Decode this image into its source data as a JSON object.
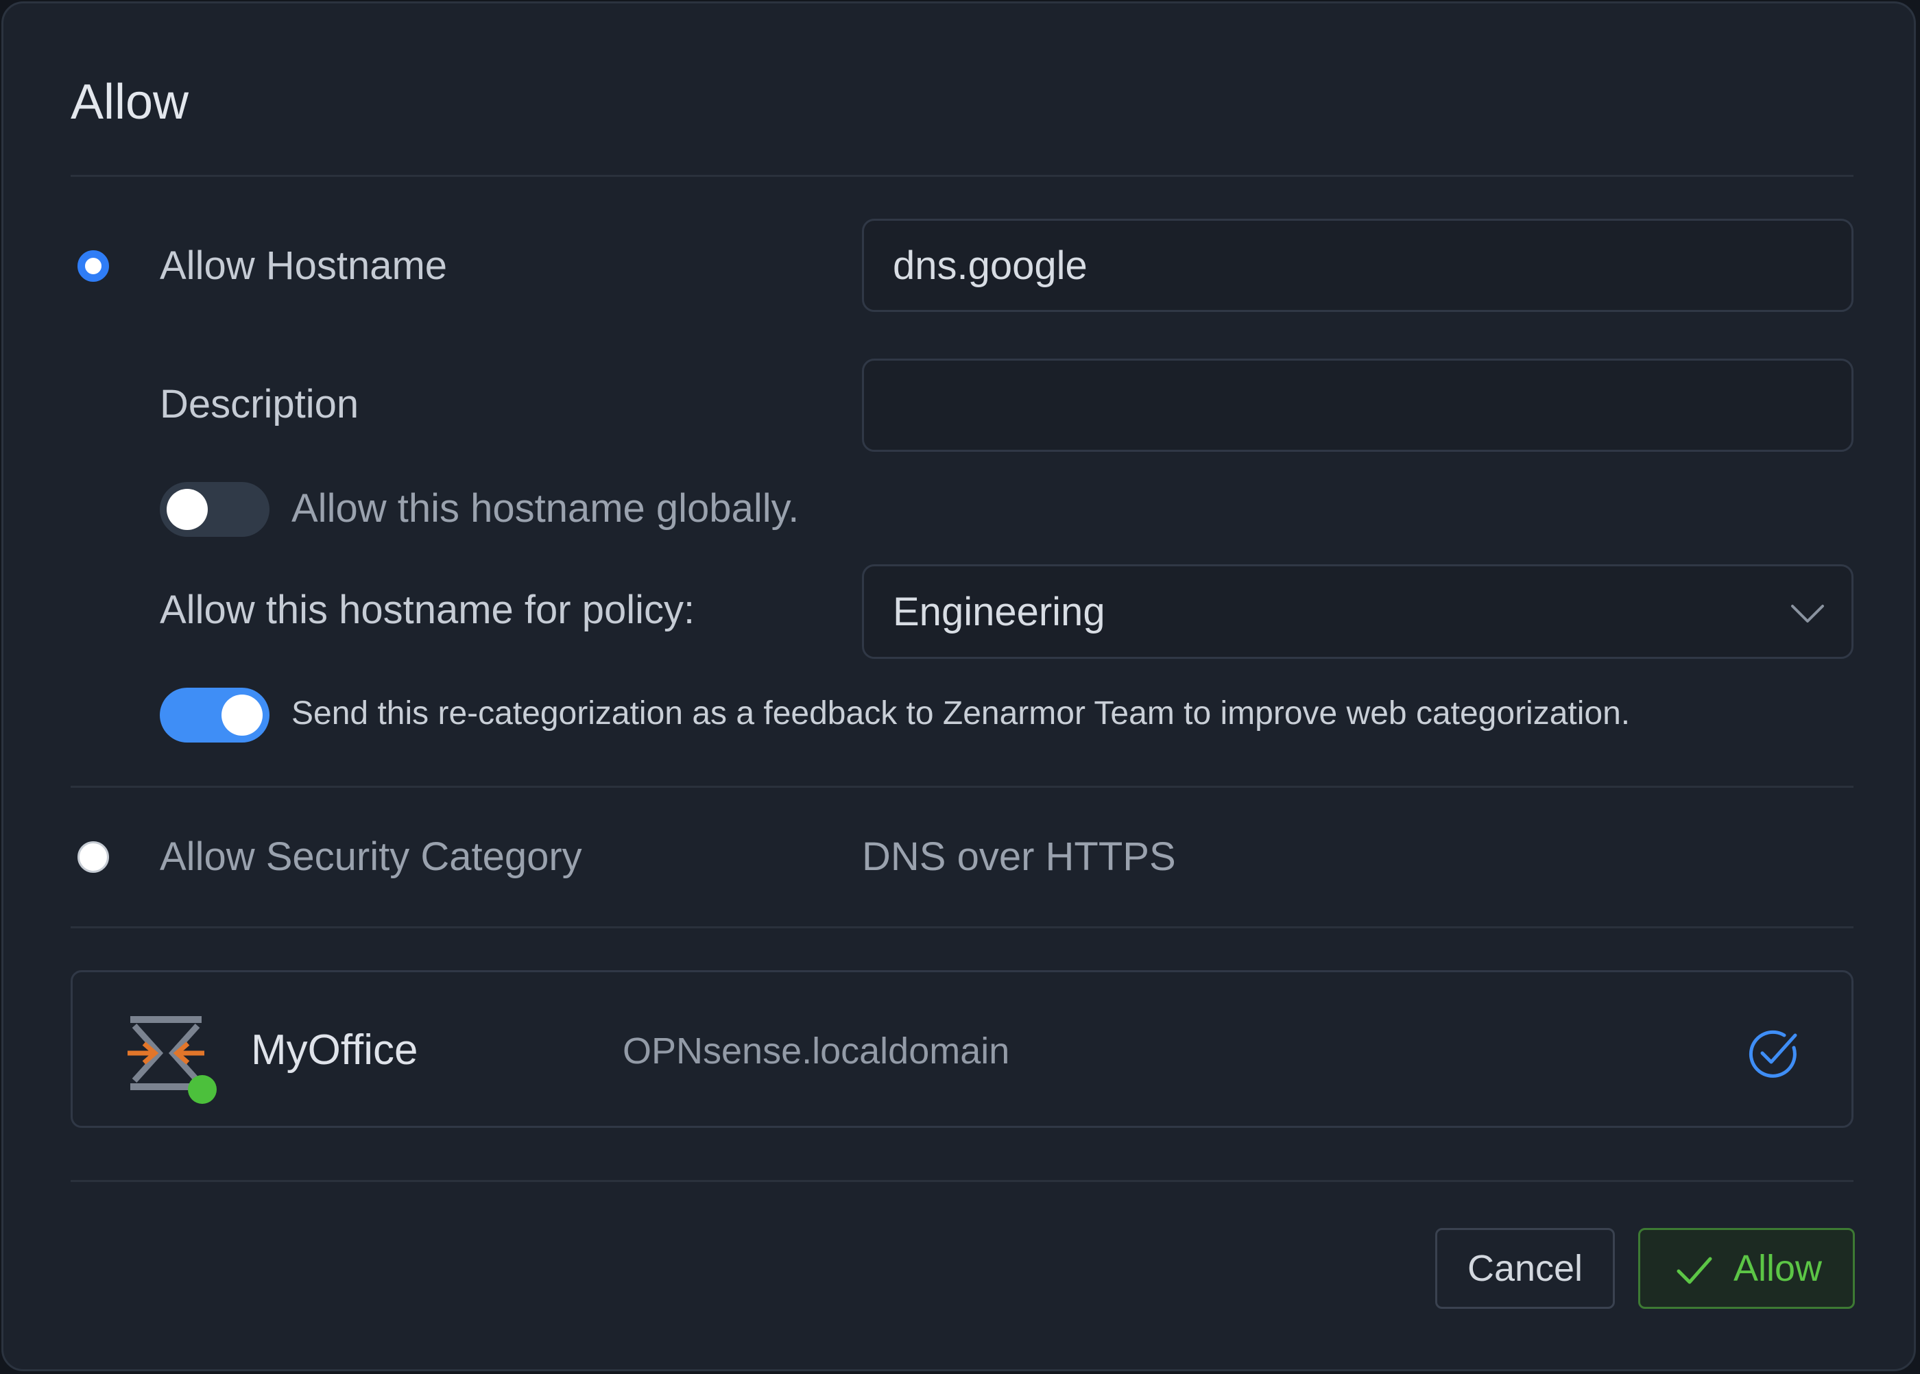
{
  "dialog": {
    "title": "Allow"
  },
  "allow_hostname": {
    "radio_label": "Allow Hostname",
    "hostname_value": "dns.google",
    "description_label": "Description",
    "description_value": "",
    "global_toggle_label": "Allow this hostname globally.",
    "global_toggle_on": false,
    "policy_label": "Allow this hostname for policy:",
    "policy_selected": "Engineering",
    "feedback_toggle_label": "Send this re-categorization as a feedback to Zenarmor Team to improve web categorization.",
    "feedback_toggle_on": true
  },
  "allow_security_category": {
    "radio_label": "Allow Security Category",
    "category_name": "DNS over HTTPS"
  },
  "device": {
    "name": "MyOffice",
    "hostname": "OPNsense.localdomain",
    "status_color": "#4cc03c",
    "selected": true
  },
  "buttons": {
    "cancel_label": "Cancel",
    "allow_label": "Allow"
  },
  "colors": {
    "accent_blue": "#2f7df6",
    "toggle_on": "#3f8ef6",
    "success_green": "#5cc646",
    "background": "#1c222c"
  }
}
